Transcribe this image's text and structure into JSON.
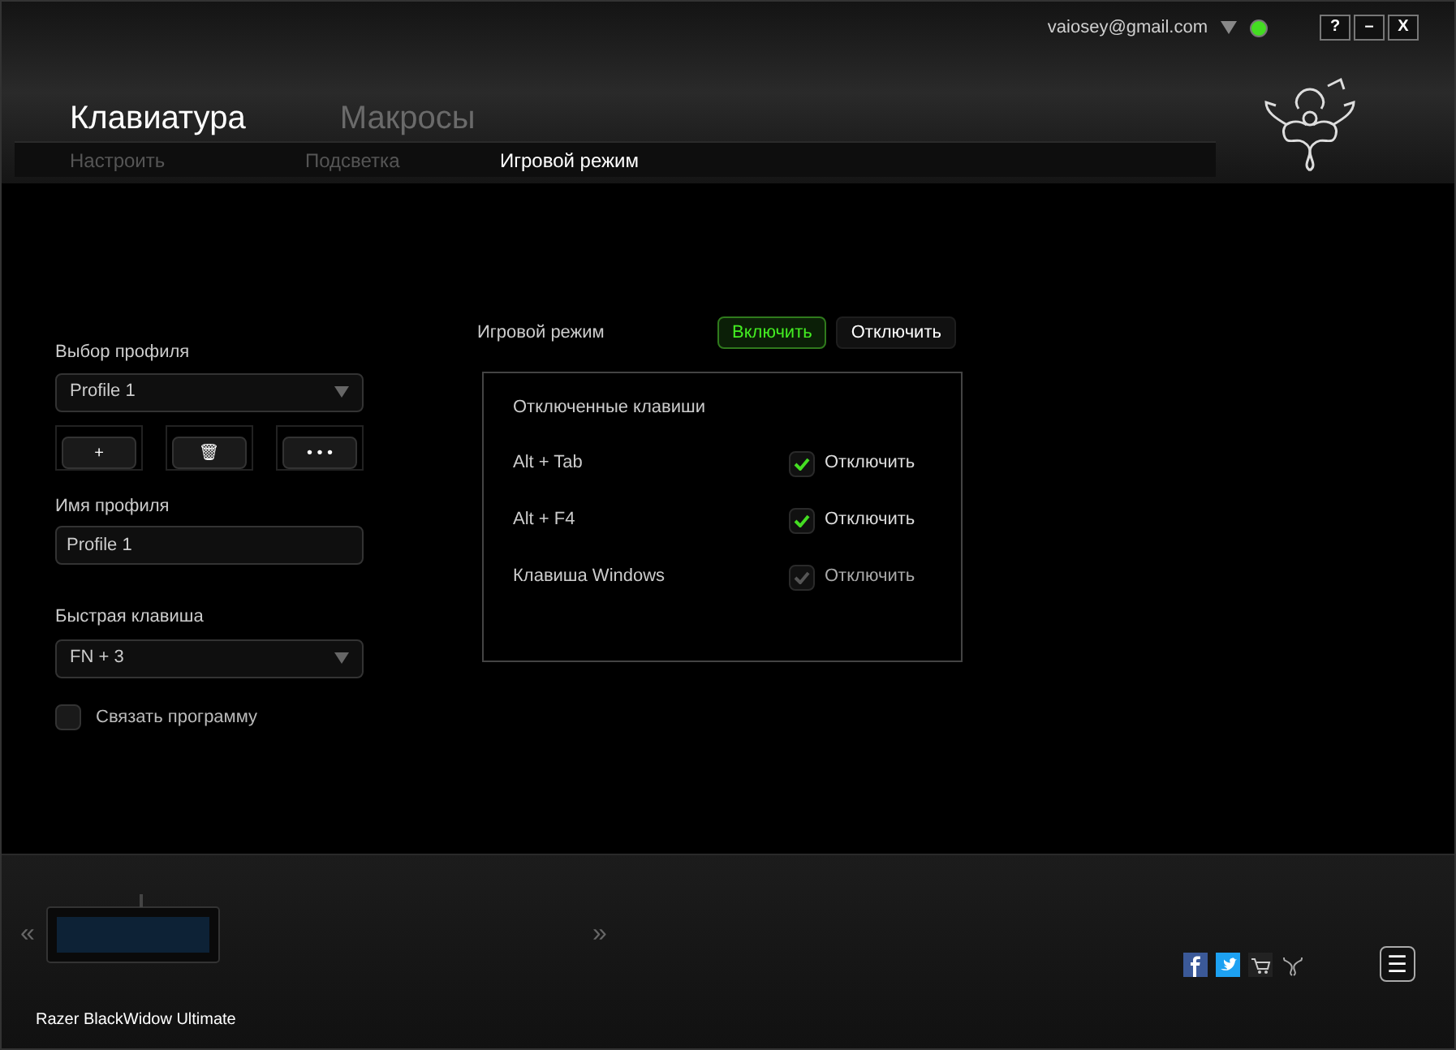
{
  "account": {
    "email": "vaiosey@gmail.com",
    "online": true
  },
  "window_buttons": [
    "?",
    "–",
    "X"
  ],
  "main_tabs": [
    {
      "label": "Клавиатура",
      "selected": true
    },
    {
      "label": "Макросы",
      "selected": false
    }
  ],
  "sub_tabs": [
    {
      "label": "Настроить",
      "selected": false
    },
    {
      "label": "Подсветка",
      "selected": false
    },
    {
      "label": "Игровой режим",
      "selected": true
    }
  ],
  "profile": {
    "select_label": "Выбор профиля",
    "select_value": "Profile 1",
    "actions": [
      "+",
      "🗑",
      "• • •"
    ],
    "name_label": "Имя профиля",
    "name_value": "Profile 1",
    "hotkey_label": "Быстрая клавиша",
    "hotkey_value": "FN + 3",
    "link_program": {
      "label": "Связать программу",
      "checked": false
    }
  },
  "game_mode": {
    "label": "Игровой режим",
    "options": [
      {
        "label": "Включить",
        "selected": true
      },
      {
        "label": "Отключить",
        "selected": false
      }
    ],
    "panel_title": "Отключенные клавиши",
    "keys": [
      {
        "name": "Alt + Tab",
        "checked": true,
        "disabled": false,
        "action": "Отключить"
      },
      {
        "name": "Alt + F4",
        "checked": true,
        "disabled": false,
        "action": "Отключить"
      },
      {
        "name": "Клавиша Windows",
        "checked": true,
        "disabled": true,
        "action": "Отключить"
      }
    ]
  },
  "footer": {
    "prev": "«",
    "next": "»",
    "device_name": "Razer BlackWidow Ultimate",
    "menu": "☰"
  }
}
